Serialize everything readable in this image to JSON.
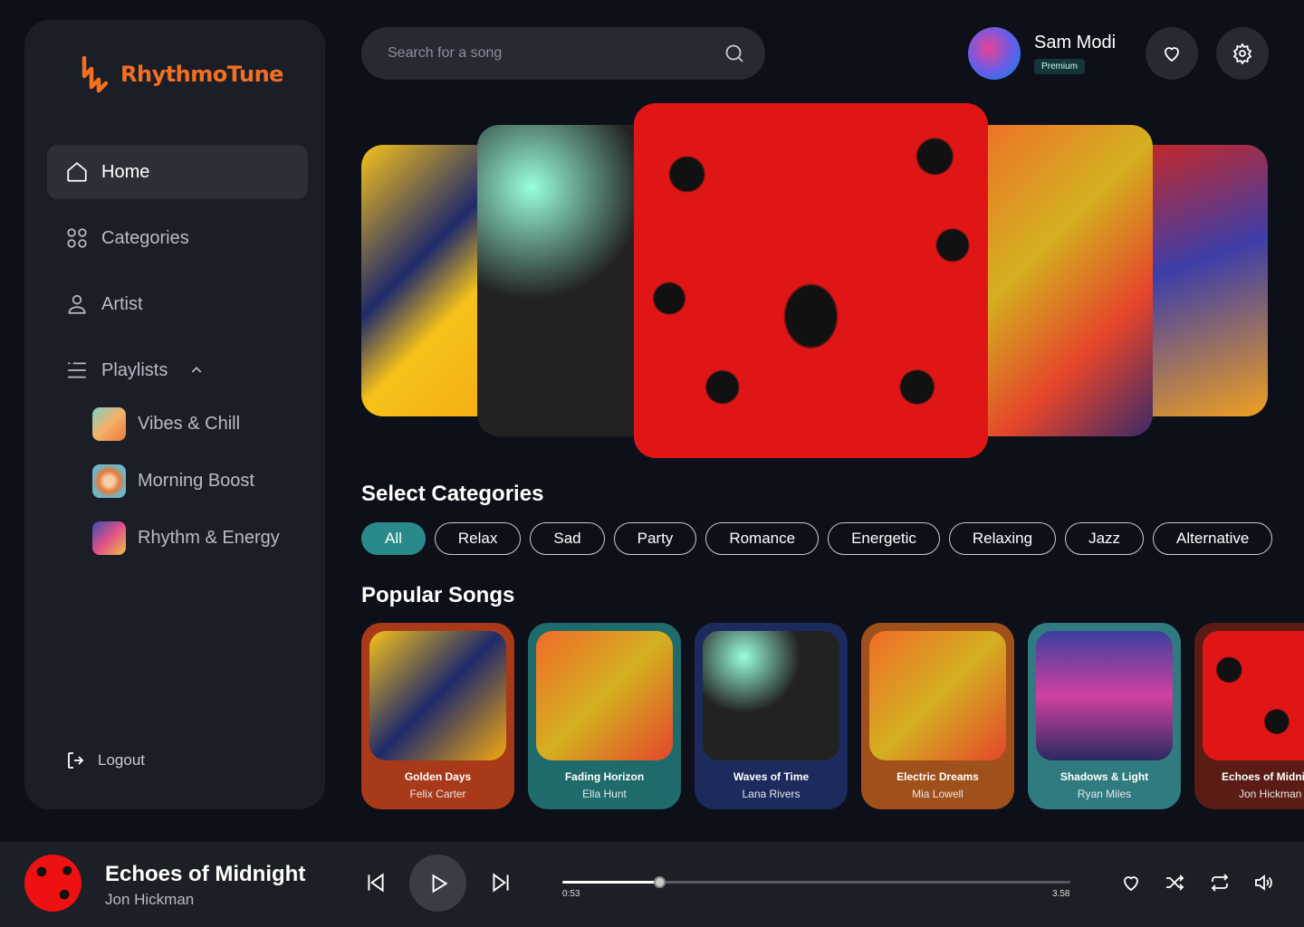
{
  "app": {
    "name": "RhythmoTune",
    "accent": "#f37021"
  },
  "sidebar": {
    "nav": [
      {
        "label": "Home",
        "icon": "home-icon",
        "active": true
      },
      {
        "label": "Categories",
        "icon": "grid-icon"
      },
      {
        "label": "Artist",
        "icon": "user-icon"
      },
      {
        "label": "Playlists",
        "icon": "list-icon"
      }
    ],
    "playlists": [
      {
        "label": "Vibes & Chill"
      },
      {
        "label": "Morning Boost"
      },
      {
        "label": "Rhythm & Energy"
      }
    ],
    "logout": "Logout"
  },
  "search": {
    "placeholder": "Search for a song"
  },
  "user": {
    "name": "Sam Modi",
    "plan": "Premium"
  },
  "categories": {
    "title": "Select Categories",
    "items": [
      "All",
      "Relax",
      "Sad",
      "Party",
      "Romance",
      "Energetic",
      "Relaxing",
      "Jazz",
      "Alternative"
    ],
    "active": "All",
    "active_color": "#2a8a8a"
  },
  "popular": {
    "title": "Popular Songs",
    "songs": [
      {
        "title": "Golden Days",
        "artist": "Felix Carter",
        "color": "#a83a1a"
      },
      {
        "title": "Fading Horizon",
        "artist": "Ella Hunt",
        "color": "#1f6b6b"
      },
      {
        "title": "Waves of Time",
        "artist": "Lana Rivers",
        "color": "#1c2a5e"
      },
      {
        "title": "Electric Dreams",
        "artist": "Mia Lowell",
        "color": "#a0501a"
      },
      {
        "title": "Shadows & Light",
        "artist": "Ryan Miles",
        "color": "#2f7b80"
      },
      {
        "title": "Echoes of Midnight",
        "artist": "Jon Hickman",
        "color": "#5a1c14"
      }
    ]
  },
  "player": {
    "title": "Echoes of Midnight",
    "artist": "Jon Hickman",
    "current": "0:53",
    "total": "3.58",
    "progress": 0.19
  }
}
